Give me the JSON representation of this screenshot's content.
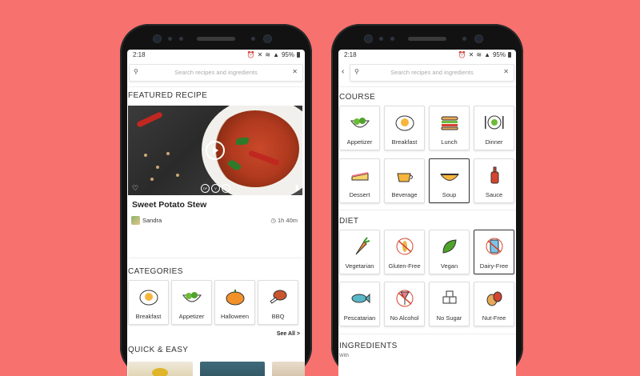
{
  "left": {
    "status": {
      "time": "2:18",
      "battery": "95%"
    },
    "search_placeholder": "Search recipes and ingredients",
    "featured_heading": "FEATURED RECIPE",
    "recipe": {
      "title": "Sweet Potato Stew",
      "author": "Sandra",
      "time": "1h 40m",
      "diet_badges": [
        "DF",
        "V",
        "GF"
      ]
    },
    "categories_heading": "CATEGORIES",
    "categories": [
      "Breakfast",
      "Appetizer",
      "Halloween",
      "BBQ"
    ],
    "see_all": "See All >",
    "quick_heading": "QUICK & EASY"
  },
  "right": {
    "status": {
      "time": "2:18",
      "battery": "95%"
    },
    "search_placeholder": "Search recipes and ingredients",
    "course_heading": "COURSE",
    "course_row1": [
      "Appetizer",
      "Breakfast",
      "Lunch",
      "Dinner"
    ],
    "course_row2": [
      "Dessert",
      "Beverage",
      "Soup",
      "Sauce"
    ],
    "diet_heading": "DIET",
    "diet_row1": [
      "Vegetarian",
      "Gluten-Free",
      "Vegan",
      "Dairy-Free"
    ],
    "diet_row2": [
      "Pescatarian",
      "No Alcohol",
      "No Sugar",
      "Nut-Free"
    ],
    "ingredients_heading": "INGREDIENTS",
    "ingredients_sub": "With"
  },
  "colors": {
    "background": "#f7716e",
    "phone": "#121212"
  }
}
